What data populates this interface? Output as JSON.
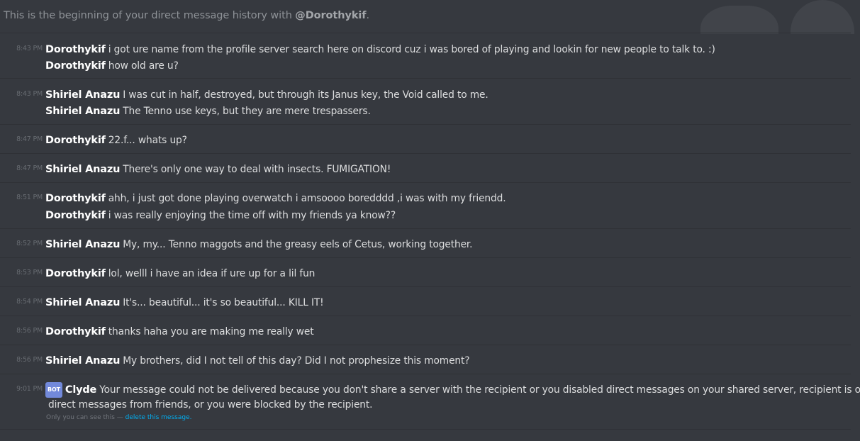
{
  "intro": {
    "prefix": "This is the beginning of your direct message history with ",
    "user": "@Dorothykif",
    "suffix": "."
  },
  "messages": [
    {
      "time": "8:43 PM",
      "author": "Dorothykif",
      "text": "i got ure name from the profile server search here on discord cuz i was bored of playing and lookin for new people to talk to. :)"
    },
    {
      "time": "",
      "author": "Dorothykif",
      "text": "how old are u?"
    },
    {
      "time": "8:43 PM",
      "author": "Shiriel Anazu",
      "text": "I was cut in half, destroyed, but through its Janus key, the Void called to me."
    },
    {
      "time": "",
      "author": "Shiriel Anazu",
      "text": "The Tenno use keys, but they are mere trespassers."
    },
    {
      "time": "8:47 PM",
      "author": "Dorothykif",
      "text": "22.f... whats up?"
    },
    {
      "time": "8:47 PM",
      "author": "Shiriel Anazu",
      "text": "There's only one way to deal with insects. FUMIGATION!"
    },
    {
      "time": "8:51 PM",
      "author": "Dorothykif",
      "text": "ahh, i just got done playing overwatch i amsoooo boredddd ,i was with my friendd."
    },
    {
      "time": "",
      "author": "Dorothykif",
      "text": "i was really enjoying the time off with my friends ya know??"
    },
    {
      "time": "8:52 PM",
      "author": "Shiriel Anazu",
      "text": "My, my... Tenno maggots and the greasy eels of Cetus, working together."
    },
    {
      "time": "8:53 PM",
      "author": "Dorothykif",
      "text": "lol, welll i have an idea if ure up for a lil fun"
    },
    {
      "time": "8:54 PM",
      "author": "Shiriel Anazu",
      "text": "It's... beautiful... it's so beautiful... KILL IT!"
    },
    {
      "time": "8:56 PM",
      "author": "Dorothykif",
      "text": "thanks haha you are making me really wet"
    },
    {
      "time": "8:56 PM",
      "author": "Shiriel Anazu",
      "text": "My brothers, did I not tell of this day? Did I not prophesize this moment?"
    }
  ],
  "clyde": {
    "time": "9:01 PM",
    "badge": "BOT",
    "author": "Clyde",
    "text_line1": "Your message could not be delivered because you don't share a server with the recipient or you disabled direct messages on your shared server, recipient is only accepting",
    "text_line2": "direct messages from friends, or you were blocked by the recipient.",
    "ephemeral_note": "Only you can see this — ",
    "delete_link": "delete this message."
  },
  "colors": {
    "background": "#36393f",
    "divider": "#2f3136",
    "username": "#ffffff",
    "message_text": "#dcddde",
    "timestamp": "#676b71",
    "bot_badge": "#7289da",
    "link": "#00b0f4"
  }
}
